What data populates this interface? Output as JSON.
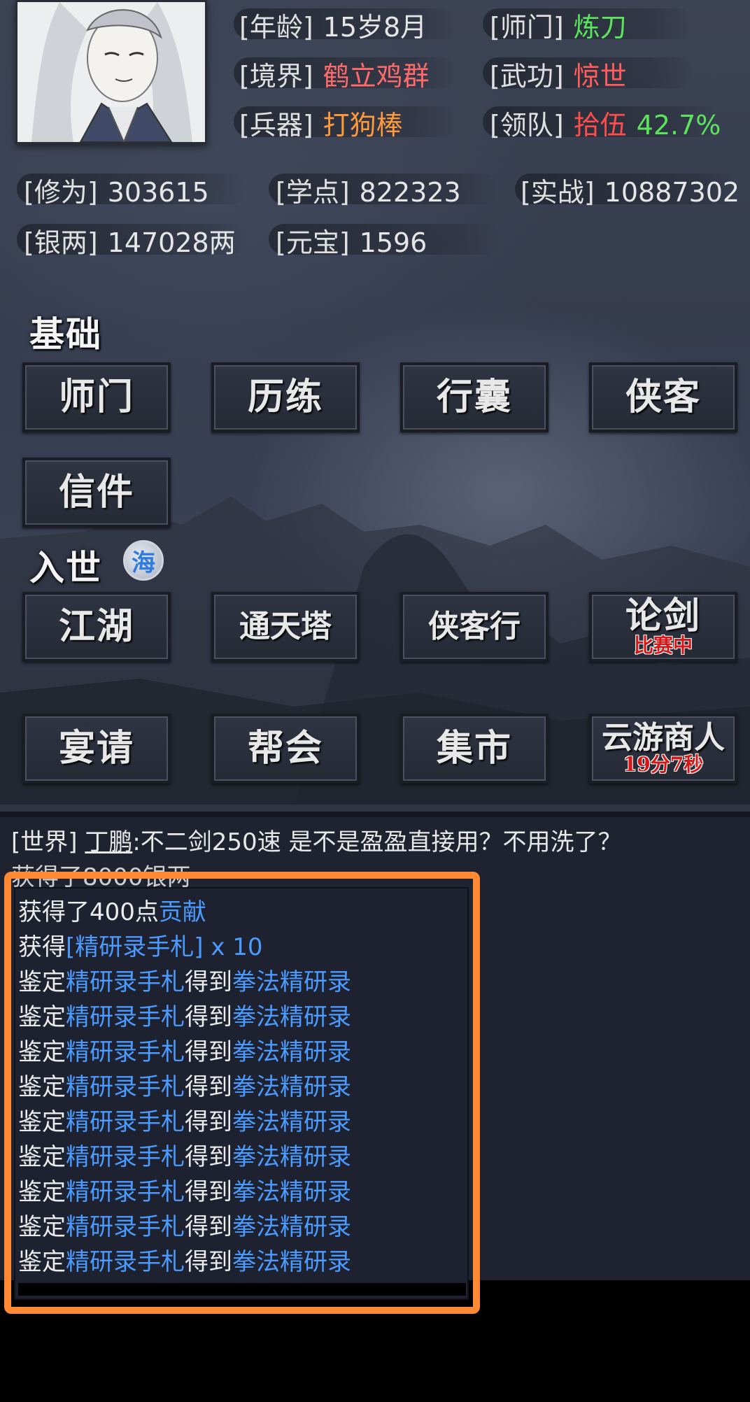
{
  "profile": {
    "age_key": "[年龄]",
    "age": "15岁8月",
    "sect_key": "[师门]",
    "sect": "炼刀",
    "realm_key": "[境界]",
    "realm": "鹤立鸡群",
    "skill_key": "[武功]",
    "skill": "惊世",
    "weapon_key": "[兵器]",
    "weapon": "打狗棒",
    "team_key": "[领队]",
    "team": "拾伍",
    "team_pct": "42.7%"
  },
  "resources": {
    "cultivation_key": "[修为]",
    "cultivation": "303615",
    "study_key": "[学点]",
    "study": "822323",
    "combat_key": "[实战]",
    "combat": "10887302",
    "silver_key": "[银两]",
    "silver": "147028两",
    "ingot_key": "[元宝]",
    "ingot": "1596"
  },
  "sections": {
    "basic": "基础",
    "world": "入世",
    "sea_badge": "海"
  },
  "buttons_basic": [
    "师门",
    "历练",
    "行囊",
    "侠客",
    "信件"
  ],
  "buttons_world": [
    {
      "label": "江湖",
      "sub": ""
    },
    {
      "label": "通天塔",
      "sub": ""
    },
    {
      "label": "侠客行",
      "sub": ""
    },
    {
      "label": "论剑",
      "sub": "比赛中"
    },
    {
      "label": "宴请",
      "sub": ""
    },
    {
      "label": "帮会",
      "sub": ""
    },
    {
      "label": "集市",
      "sub": ""
    },
    {
      "label": "云游商人",
      "sub": "19分7秒"
    }
  ],
  "chat": {
    "channel": "[世界]",
    "user": "丁鹏",
    "message": ":不二剑250速 是不是盈盈直接用？不用洗了？",
    "partial_line": "获得了8000银两"
  },
  "log": {
    "line1_prefix": "获得了400点",
    "line1_link": "贡献",
    "line2_prefix": "获得",
    "line2_link": "[精研录手札] x 10",
    "appraise_prefix": "鉴定",
    "appraise_item": "精研录手札",
    "appraise_mid": "得到",
    "appraise_result": "拳法精研录",
    "appraise_count": 9
  },
  "colors": {
    "green": "#5be35b",
    "red": "#ff5c5c",
    "orange": "#ff9a3c",
    "blue_link": "#4b9bff",
    "highlight": "#ff8a33",
    "badge_red": "#d41818"
  }
}
